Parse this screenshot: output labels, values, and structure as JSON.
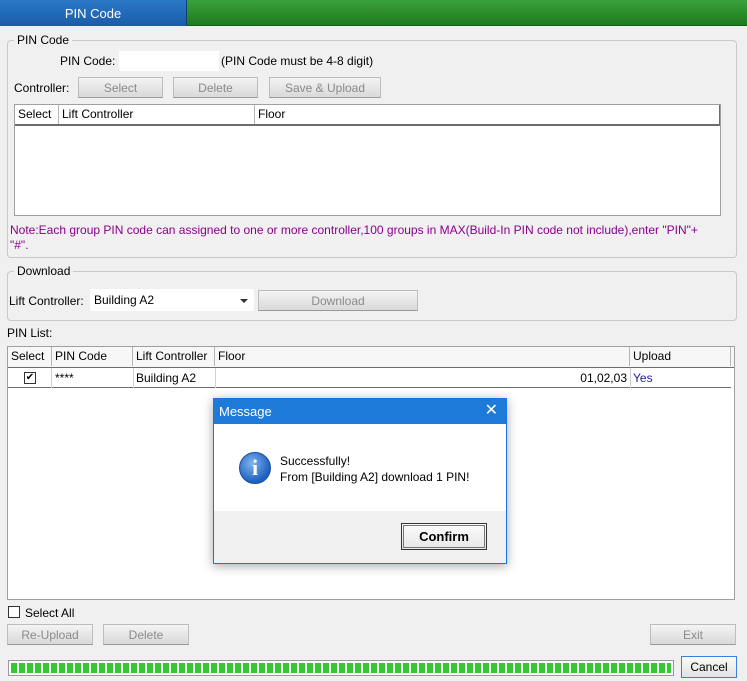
{
  "window": {
    "active_tab": "PIN Code"
  },
  "pin_group": {
    "legend": "PIN Code",
    "pin_label": "PIN Code:",
    "pin_value": "",
    "pin_hint": "(PIN Code must be 4-8 digit)",
    "controller_label": "Controller:",
    "buttons": {
      "select": "Select",
      "delete": "Delete",
      "save_upload": "Save & Upload"
    },
    "table_headers": {
      "select": "Select",
      "lift_controller": "Lift Controller",
      "floor": "Floor"
    },
    "note": "Note:Each group PIN code can assigned to one or more controller,100 groups in MAX(Build-In PIN code not include),enter \"PIN\"+",
    "note_line2": "\"#\"."
  },
  "download_group": {
    "legend": "Download",
    "lift_label": "Lift Controller:",
    "lift_selected": "Building A2",
    "download_button": "Download"
  },
  "pin_list": {
    "label": "PIN List:",
    "headers": {
      "select": "Select",
      "pin_code": "PIN Code",
      "lift_controller": "Lift Controller",
      "floor": "Floor",
      "upload": "Upload"
    },
    "rows": [
      {
        "checked": "✔",
        "pin_code": "****",
        "lift_controller": "Building A2",
        "floor": "01,02,03",
        "upload": "Yes"
      }
    ]
  },
  "bottom": {
    "select_all": "Select All",
    "reupload": "Re-Upload",
    "delete": "Delete",
    "exit": "Exit",
    "cancel": "Cancel"
  },
  "progress": {
    "fraction": 1.0
  },
  "modal": {
    "title": "Message",
    "close_glyph": "✕",
    "icon_glyph": "i",
    "line1": "Successfully!",
    "line2": "From [Building A2] download 1 PIN!",
    "confirm": "Confirm"
  },
  "colors": {
    "accent_blue": "#1e7ad8",
    "note_purple": "#8b008b",
    "progress_green": "#32c832",
    "tab_green": "#2a8f2a"
  }
}
